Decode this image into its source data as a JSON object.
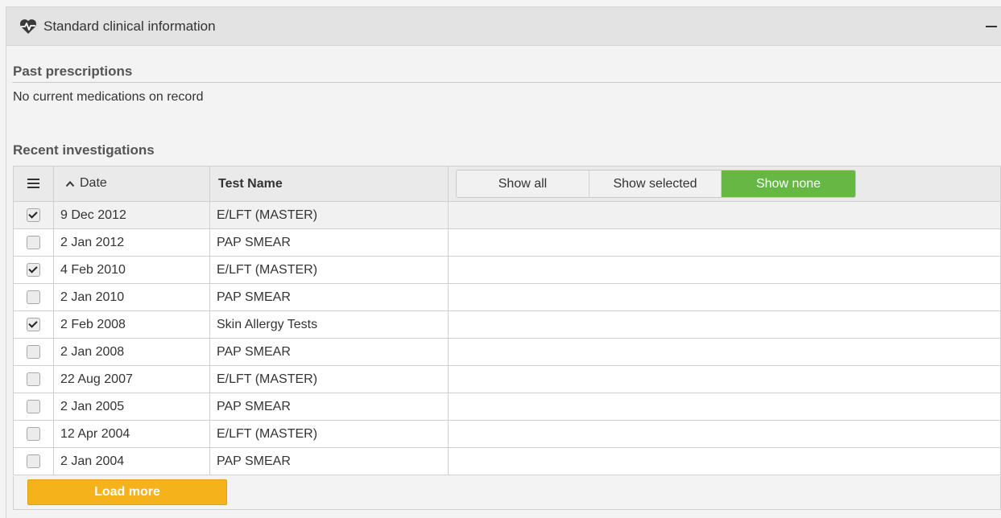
{
  "panel": {
    "title": "Standard clinical information",
    "header_icon": "heart-pulse-icon",
    "collapse_icon": "minus-icon"
  },
  "past_prescriptions": {
    "title": "Past prescriptions",
    "empty_text": "No current medications on record"
  },
  "recent_investigations": {
    "title": "Recent investigations",
    "columns": {
      "menu_icon": "hamburger-menu-icon",
      "date": "Date",
      "date_sort_icon": "chevron-up-icon",
      "test_name": "Test Name"
    },
    "filter": {
      "show_all": "Show all",
      "show_selected": "Show selected",
      "show_none": "Show none",
      "active": "show_none",
      "active_color": "#66b845"
    },
    "rows": [
      {
        "checked": true,
        "date": "9 Dec 2012",
        "test_name": "E/LFT (MASTER)"
      },
      {
        "checked": false,
        "date": "2 Jan 2012",
        "test_name": "PAP SMEAR"
      },
      {
        "checked": true,
        "date": "4 Feb 2010",
        "test_name": "E/LFT (MASTER)"
      },
      {
        "checked": false,
        "date": "2 Jan 2010",
        "test_name": "PAP SMEAR"
      },
      {
        "checked": true,
        "date": "2 Feb 2008",
        "test_name": "Skin Allergy Tests"
      },
      {
        "checked": false,
        "date": "2 Jan 2008",
        "test_name": "PAP SMEAR"
      },
      {
        "checked": false,
        "date": "22 Aug 2007",
        "test_name": "E/LFT (MASTER)"
      },
      {
        "checked": false,
        "date": "2 Jan 2005",
        "test_name": "PAP SMEAR"
      },
      {
        "checked": false,
        "date": "12 Apr 2004",
        "test_name": "E/LFT (MASTER)"
      },
      {
        "checked": false,
        "date": "2 Jan 2004",
        "test_name": "PAP SMEAR"
      }
    ],
    "load_more": "Load more",
    "load_more_color": "#f6b21b"
  }
}
